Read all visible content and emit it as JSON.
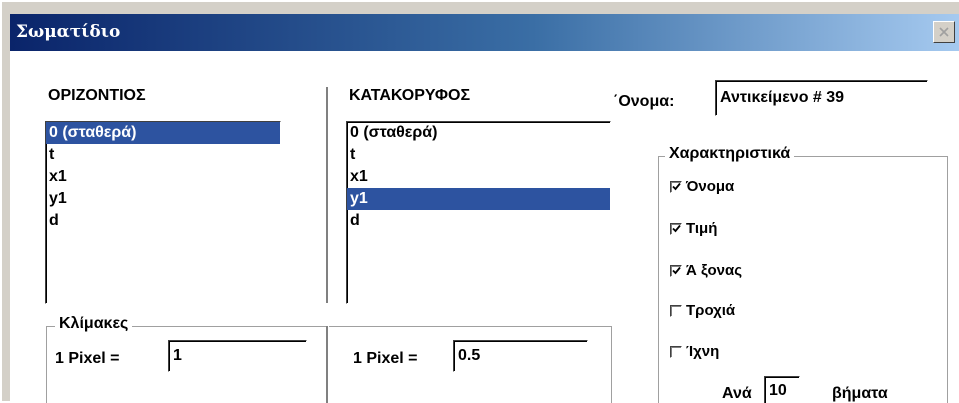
{
  "window": {
    "title": "Σωματίδιο"
  },
  "horizontal": {
    "heading": "ΟΡΙΖΟΝΤΙΟΣ",
    "items": [
      {
        "label": "0 (σταθερά)",
        "selected": true
      },
      {
        "label": "t",
        "selected": false
      },
      {
        "label": "x1",
        "selected": false
      },
      {
        "label": "y1",
        "selected": false
      },
      {
        "label": "d",
        "selected": false
      }
    ]
  },
  "vertical": {
    "heading": "ΚΑΤΑΚΟΡΥΦΟΣ",
    "items": [
      {
        "label": "0 (σταθερά)",
        "selected": false
      },
      {
        "label": "t",
        "selected": false
      },
      {
        "label": "x1",
        "selected": false
      },
      {
        "label": "y1",
        "selected": true
      },
      {
        "label": "d",
        "selected": false
      }
    ]
  },
  "scales": {
    "legend": "Κλίμακες",
    "horizontal": {
      "label": "1 Pixel =",
      "value": "1"
    },
    "vertical": {
      "label": "1 Pixel =",
      "value": "0.5"
    }
  },
  "name_field": {
    "label": "΄Ονομα:",
    "value": "Αντικείμενο # 39"
  },
  "characteristics": {
    "legend": "Χαρακτηριστικά",
    "options": [
      {
        "label": "Όνομα",
        "checked": true
      },
      {
        "label": "Τιμή",
        "checked": true
      },
      {
        "label": "Ά ξονας",
        "checked": true
      },
      {
        "label": "Τροχιά",
        "checked": false
      },
      {
        "label": "Ίχνη",
        "checked": false
      }
    ],
    "steps": {
      "prefix": "Ανά",
      "value": "10",
      "suffix": "βήματα"
    }
  }
}
